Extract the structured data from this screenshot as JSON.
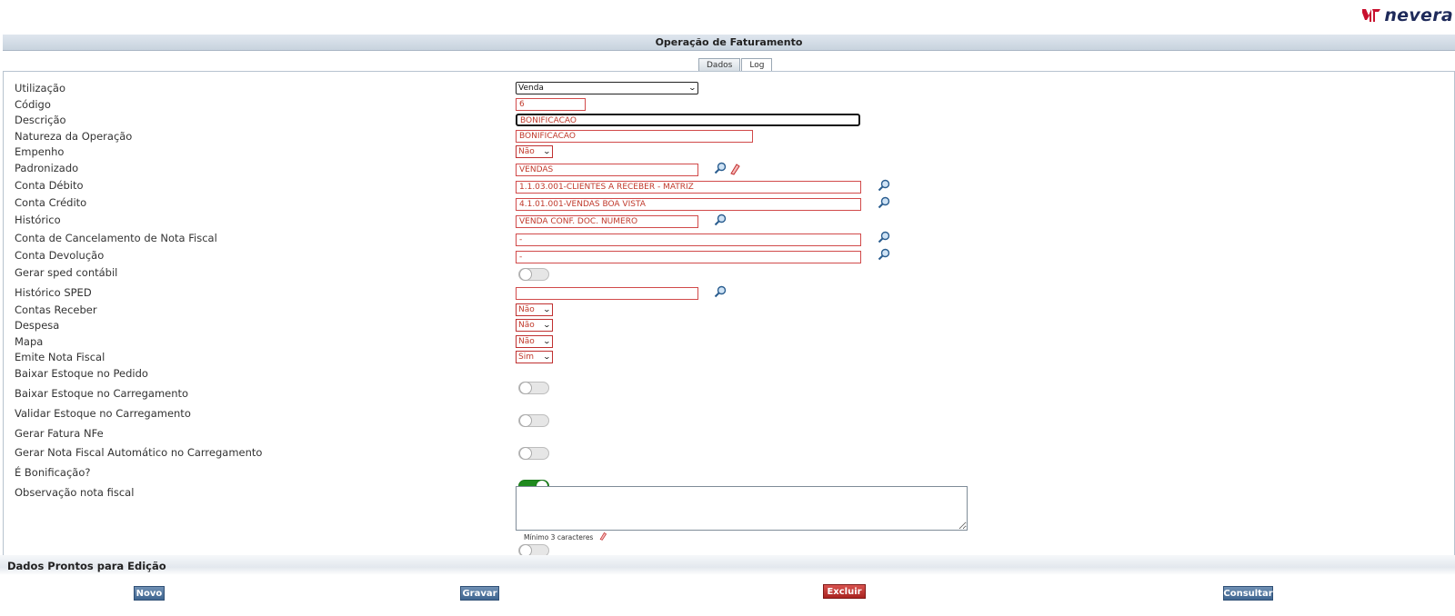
{
  "brand": {
    "logo_text": "nevera",
    "accent": "#c8102e"
  },
  "page": {
    "title": "Operação de Faturamento"
  },
  "tabs": [
    {
      "label": "Dados",
      "active": false
    },
    {
      "label": "Log",
      "active": true
    }
  ],
  "form": {
    "utilizacao": {
      "label": "Utilização",
      "value": "Venda"
    },
    "codigo": {
      "label": "Código",
      "value": "6"
    },
    "descricao": {
      "label": "Descrição",
      "value": "BONIFICACAO"
    },
    "natureza": {
      "label": "Natureza da Operação",
      "value": "BONIFICACAO"
    },
    "empenho": {
      "label": "Empenho",
      "value": "Não"
    },
    "padronizado": {
      "label": "Padronizado",
      "value": "VENDAS"
    },
    "conta_debito": {
      "label": "Conta Débito",
      "value": "1.1.03.001-CLIENTES A RECEBER - MATRIZ"
    },
    "conta_credito": {
      "label": "Conta Crédito",
      "value": "4.1.01.001-VENDAS BOA VISTA"
    },
    "historico": {
      "label": "Histórico",
      "value": "VENDA CONF. DOC. NUMERO"
    },
    "conta_cancelamento": {
      "label": "Conta de Cancelamento de Nota Fiscal",
      "value": "-"
    },
    "conta_devolucao": {
      "label": "Conta Devolução",
      "value": "-"
    },
    "gerar_sped": {
      "label": "Gerar sped contábil",
      "on": false
    },
    "historico_sped": {
      "label": "Histórico SPED",
      "value": ""
    },
    "contas_receber": {
      "label": "Contas Receber",
      "value": "Não"
    },
    "despesa": {
      "label": "Despesa",
      "value": "Não"
    },
    "mapa": {
      "label": "Mapa",
      "value": "Não"
    },
    "emite_nf": {
      "label": "Emite Nota Fiscal",
      "value": "Sim"
    },
    "baixar_pedido": {
      "label": "Baixar Estoque no Pedido",
      "on": false
    },
    "baixar_carregamento": {
      "label": "Baixar Estoque no Carregamento",
      "on": false
    },
    "validar_estoque": {
      "label": "Validar Estoque no Carregamento",
      "on": false
    },
    "gerar_fatura": {
      "label": "Gerar Fatura NFe",
      "on": true
    },
    "gerar_nf_auto": {
      "label": "Gerar Nota Fiscal Automático no Carregamento",
      "on": false
    },
    "bonificacao": {
      "label": "É Bonificação?",
      "on": false
    },
    "observacao": {
      "label": "Observação nota fiscal",
      "value": "",
      "hint": "Mínimo 3 caracteres"
    }
  },
  "status": {
    "text": "Dados Prontos para Edição"
  },
  "buttons": {
    "novo": "Novo",
    "gravar": "Gravar",
    "excluir": "Excluir",
    "consultar": "Consultar"
  }
}
